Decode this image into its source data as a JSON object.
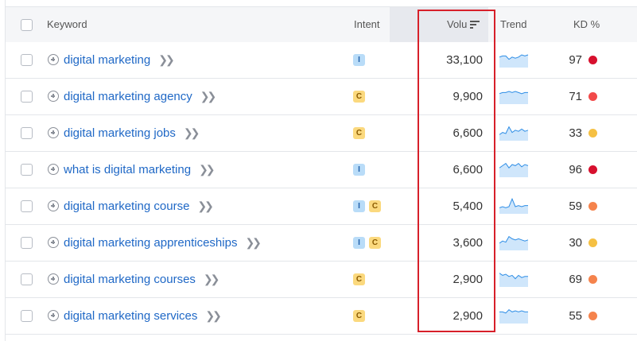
{
  "header": {
    "keyword": "Keyword",
    "intent": "Intent",
    "volume": "Volu",
    "trend": "Trend",
    "kd": "KD %"
  },
  "rows": [
    {
      "keyword": "digital marketing",
      "intent": [
        "I"
      ],
      "volume": "33,100",
      "kd": "97",
      "kd_color": "#d7102e",
      "trend": [
        8,
        9,
        9,
        6,
        8,
        7,
        8,
        10,
        9,
        10
      ]
    },
    {
      "keyword": "digital marketing agency",
      "intent": [
        "C"
      ],
      "volume": "9,900",
      "kd": "71",
      "kd_color": "#f24a4a",
      "trend": [
        8,
        9,
        9,
        10,
        9,
        10,
        9,
        8,
        9,
        9
      ]
    },
    {
      "keyword": "digital marketing jobs",
      "intent": [
        "C"
      ],
      "volume": "6,600",
      "kd": "33",
      "kd_color": "#f5c043",
      "trend": [
        4,
        6,
        5,
        11,
        6,
        8,
        7,
        9,
        7,
        8
      ]
    },
    {
      "keyword": "what is digital marketing",
      "intent": [
        "I"
      ],
      "volume": "6,600",
      "kd": "96",
      "kd_color": "#d7102e",
      "trend": [
        7,
        9,
        11,
        7,
        10,
        9,
        11,
        8,
        10,
        9
      ]
    },
    {
      "keyword": "digital marketing course",
      "intent": [
        "I",
        "C"
      ],
      "volume": "5,400",
      "kd": "59",
      "kd_color": "#f5834c",
      "trend": [
        4,
        5,
        4,
        5,
        12,
        5,
        6,
        5,
        6,
        6
      ]
    },
    {
      "keyword": "digital marketing apprenticeships",
      "intent": [
        "I",
        "C"
      ],
      "volume": "3,600",
      "kd": "30",
      "kd_color": "#f5c043",
      "trend": [
        5,
        7,
        6,
        11,
        9,
        8,
        9,
        8,
        7,
        8
      ]
    },
    {
      "keyword": "digital marketing courses",
      "intent": [
        "C"
      ],
      "volume": "2,900",
      "kd": "69",
      "kd_color": "#f5834c",
      "trend": [
        11,
        9,
        10,
        8,
        9,
        6,
        9,
        7,
        8,
        8
      ]
    },
    {
      "keyword": "digital marketing services",
      "intent": [
        "C"
      ],
      "volume": "2,900",
      "kd": "55",
      "kd_color": "#f5834c",
      "trend": [
        9,
        9,
        8,
        11,
        9,
        10,
        9,
        10,
        9,
        9
      ]
    }
  ],
  "icons": {
    "add": "plus-circle-icon",
    "expand": "double-chevron-right-icon",
    "sort": "sort-descending-icon"
  },
  "colors": {
    "link": "#1f68c6",
    "highlight": "#d7202a",
    "trend_fill": "#cfe6fb",
    "trend_line": "#2f8ee6"
  }
}
